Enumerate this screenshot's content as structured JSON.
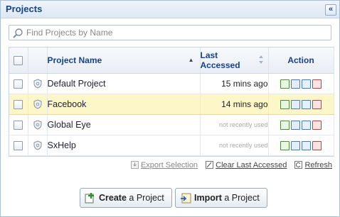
{
  "panel": {
    "title": "Projects",
    "collapse_glyph": "«"
  },
  "search": {
    "placeholder": "Find Projects by Name",
    "value": ""
  },
  "columns": {
    "name": "Project Name",
    "last_accessed_line1": "Last",
    "last_accessed_line2": "Accessed",
    "action": "Action"
  },
  "rows": [
    {
      "name": "Default Project",
      "last_accessed": "15 mins ago",
      "recent": true,
      "highlighted": false
    },
    {
      "name": "Facebook",
      "last_accessed": "14 mins ago",
      "recent": true,
      "highlighted": true
    },
    {
      "name": "Global Eye",
      "last_accessed": "not recently used",
      "recent": false,
      "highlighted": false
    },
    {
      "name": "SxHelp",
      "last_accessed": "not recently used",
      "recent": false,
      "highlighted": false
    }
  ],
  "links": {
    "export": "Export Selection",
    "clear": "Clear Last Accessed",
    "refresh": "Refresh"
  },
  "buttons": {
    "create_bold": "Create",
    "create_rest": " a Project",
    "import_bold": "Import",
    "import_rest": " a Project"
  },
  "colors": {
    "accent": "#15428b",
    "highlight_row": "#fdf6c8",
    "border": "#a9bfd6"
  },
  "icons": [
    "collapse-icon",
    "search-icon",
    "shield-icon",
    "edit-icon",
    "copy-icon",
    "export-icon",
    "delete-icon",
    "refresh-icon",
    "clear-icon",
    "create-project-icon",
    "import-project-icon"
  ]
}
